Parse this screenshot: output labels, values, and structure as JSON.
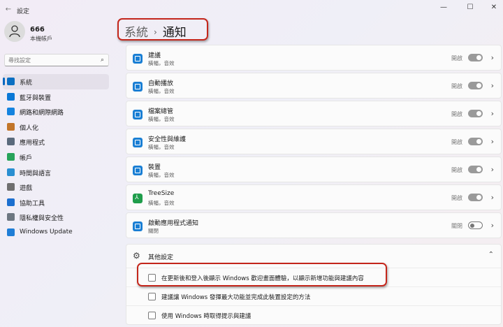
{
  "window": {
    "title": "設定",
    "minimize": "—",
    "maximize": "☐",
    "close": "✕",
    "back": "←"
  },
  "profile": {
    "name": "666",
    "subtitle": "本機帳戶"
  },
  "search": {
    "placeholder": "尋找設定",
    "icon": "search-icon"
  },
  "sidebar": {
    "items": [
      {
        "label": "系統",
        "icon": "monitor-icon",
        "color": "#0a6fc2",
        "active": true
      },
      {
        "label": "藍牙與裝置",
        "icon": "bluetooth-icon",
        "color": "#0a78d6"
      },
      {
        "label": "網路和網際網路",
        "icon": "wifi-icon",
        "color": "#1583df"
      },
      {
        "label": "個人化",
        "icon": "brush-icon",
        "color": "#c2752a"
      },
      {
        "label": "應用程式",
        "icon": "apps-icon",
        "color": "#5b6a7c"
      },
      {
        "label": "帳戶",
        "icon": "person-icon",
        "color": "#27a35a"
      },
      {
        "label": "時間與語言",
        "icon": "globe-icon",
        "color": "#2a8fd1"
      },
      {
        "label": "遊戲",
        "icon": "gamepad-icon",
        "color": "#6f6f6f"
      },
      {
        "label": "協助工具",
        "icon": "accessibility-icon",
        "color": "#1c6fcf"
      },
      {
        "label": "隱私權與安全性",
        "icon": "shield-icon",
        "color": "#6d7781"
      },
      {
        "label": "Windows Update",
        "icon": "update-icon",
        "color": "#1f7ed6"
      }
    ]
  },
  "breadcrumb": {
    "parent": "系統",
    "separator": "›",
    "current": "通知"
  },
  "apps": [
    {
      "name": "建議",
      "desc": "橫幅，音效",
      "state": "開啟",
      "on": true
    },
    {
      "name": "自動播放",
      "desc": "橫幅，音效",
      "state": "開啟",
      "on": true
    },
    {
      "name": "檔案總管",
      "desc": "橫幅，音效",
      "state": "開啟",
      "on": true
    },
    {
      "name": "安全性與維護",
      "desc": "橫幅，音效",
      "state": "開啟",
      "on": true
    },
    {
      "name": "裝置",
      "desc": "橫幅，音效",
      "state": "開啟",
      "on": true
    },
    {
      "name": "TreeSize",
      "desc": "橫幅，音效",
      "state": "開啟",
      "on": true
    },
    {
      "name": "啟動應用程式通知",
      "desc": "關閉",
      "state": "關閉",
      "on": false
    }
  ],
  "more_settings": {
    "title": "其他設定",
    "options": [
      {
        "label": "在更新後和登入後顯示 Windows 歡迎畫面體驗，以顯示新增功能與建議內容",
        "checked": false
      },
      {
        "label": "建議讓 Windows 發揮最大功能並完成此裝置設定的方法",
        "checked": false
      },
      {
        "label": "使用 Windows 時取得提示與建議",
        "checked": false
      }
    ]
  },
  "colors": {
    "accent": "#0067c0",
    "highlight": "#c4261b"
  }
}
